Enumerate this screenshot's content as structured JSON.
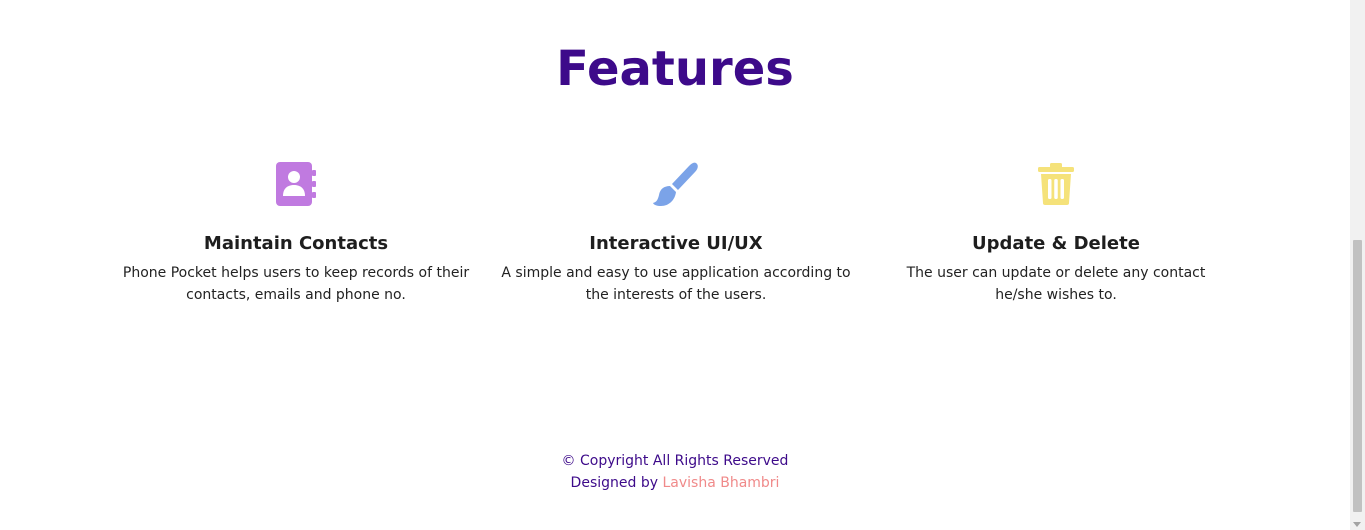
{
  "section_title": "Features",
  "features": [
    {
      "icon": "address-book-icon",
      "color": "#c07ae0",
      "title": "Maintain Contacts",
      "description": "Phone Pocket helps users to keep records of their contacts, emails and phone no."
    },
    {
      "icon": "paint-brush-icon",
      "color": "#7ba3e8",
      "title": "Interactive UI/UX",
      "description": "A simple and easy to use application according to the interests of the users."
    },
    {
      "icon": "trash-icon",
      "color": "#f5e27a",
      "title": "Update & Delete",
      "description": "The user can update or delete any contact he/she wishes to."
    }
  ],
  "footer": {
    "copyright": "© Copyright All Rights Reserved",
    "designed_by": "Designed by",
    "author": "Lavisha Bhambri"
  },
  "colors": {
    "primary": "#3d0a8a",
    "author_link": "#f08a8a"
  }
}
